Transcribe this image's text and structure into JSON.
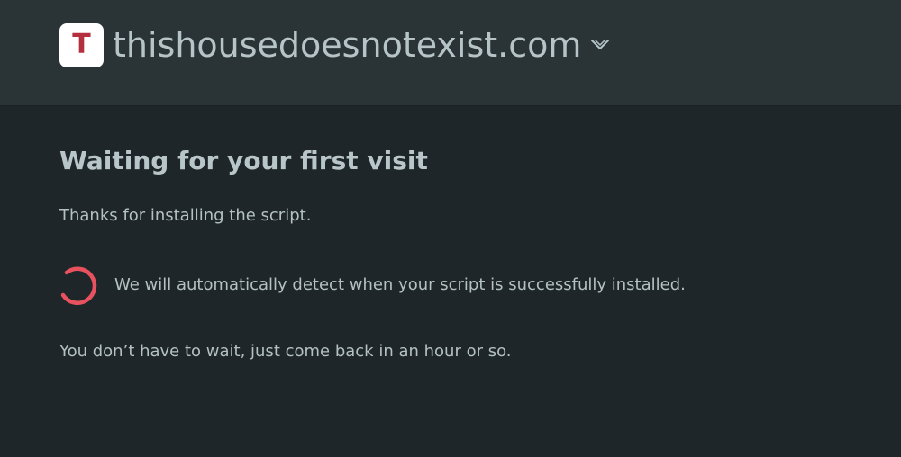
{
  "header": {
    "favicon_letter": "T",
    "site_name": "thishousedoesnotexist.com",
    "dropdown_icon": "chevron-down-icon"
  },
  "main": {
    "heading": "Waiting for your first visit",
    "thanks_text": "Thanks for installing the script.",
    "detect_text": "We will automatically detect when your script is successfully installed.",
    "wait_text": "You don’t have to wait, just come back in an hour or so."
  },
  "colors": {
    "background": "#1f2629",
    "header_background": "#2a3437",
    "text": "#b3c0c4",
    "accent": "#e8525f",
    "favicon_letter": "#b5303f"
  },
  "icons": {
    "spinner": "loading-spinner-icon"
  }
}
